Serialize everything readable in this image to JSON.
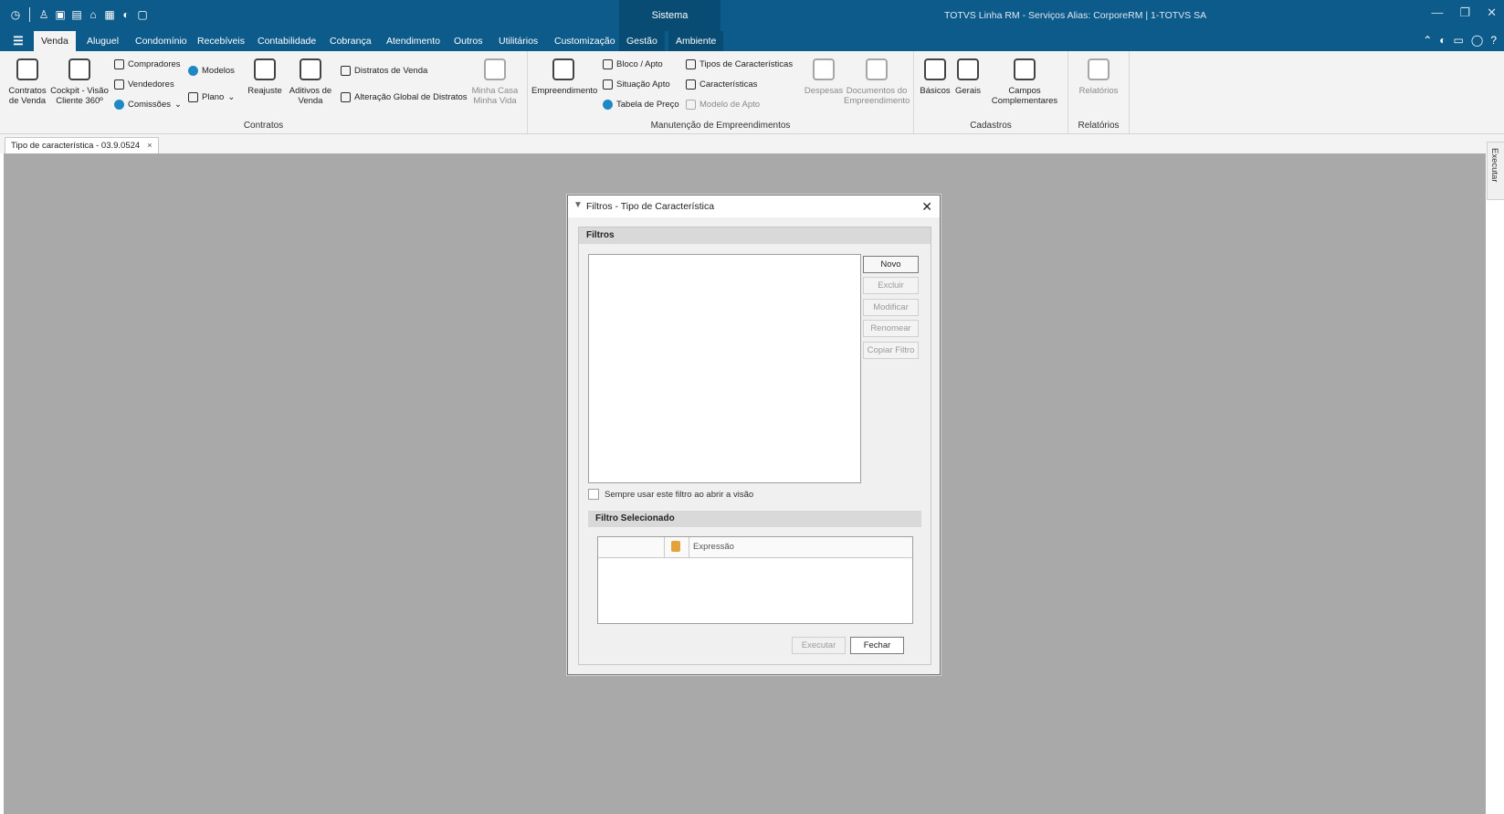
{
  "window": {
    "system_tab": "Sistema",
    "app_info": "TOTVS Linha RM - Serviços  Alias: CorporeRM | 1-TOTVS SA"
  },
  "tabs": [
    "Venda",
    "Aluguel",
    "Condomínio",
    "Recebíveis",
    "Contabilidade",
    "Cobrança",
    "Atendimento",
    "Outros",
    "Utilitários",
    "Customização",
    "Gestão",
    "Ambiente"
  ],
  "ribbon": {
    "contratos": {
      "group_label": "Contratos",
      "contratos_venda": "Contratos de Venda",
      "cockpit": "Cockpit - Visão Cliente 360º",
      "compradores": "Compradores",
      "vendedores": "Vendedores",
      "comissoes": "Comissões",
      "modelos": "Modelos",
      "plano": "Plano",
      "reajuste": "Reajuste",
      "aditivos": "Aditivos de Venda",
      "distratos": "Distratos de Venda",
      "alteracao": "Alteração Global de Distratos",
      "minha_casa": "Minha Casa Minha Vida"
    },
    "manutencao": {
      "group_label": "Manutenção de Empreendimentos",
      "empreendimento": "Empreendimento",
      "bloco": "Bloco / Apto",
      "situacao": "Situação Apto",
      "tabela": "Tabela de Preço",
      "tipos_caract": "Tipos de Características",
      "caracteristicas": "Características",
      "modelo_apto": "Modelo de Apto",
      "despesas": "Despesas",
      "documentos": "Documentos do Empreendimento"
    },
    "cadastros": {
      "group_label": "Cadastros",
      "basicos": "Básicos",
      "gerais": "Gerais",
      "campos": "Campos Complementares"
    },
    "relatorios": {
      "group_label": "Relatórios",
      "relatorios": "Relatórios"
    }
  },
  "doc_tab": {
    "label": "Tipo de característica - 03.9.0524",
    "close": "×"
  },
  "side_panel": {
    "label": "Executar"
  },
  "dialog": {
    "title": "Filtros - Tipo de Característica",
    "close": "✕",
    "section_filtros": "Filtros",
    "buttons": {
      "novo": "Novo",
      "excluir": "Excluir",
      "modificar": "Modificar",
      "renomear": "Renomear",
      "copiar": "Copiar Filtro"
    },
    "checkbox": "Sempre usar este filtro ao abrir a visão",
    "section_selecionado": "Filtro Selecionado",
    "grid_header": "Expressão",
    "executar": "Executar",
    "fechar": "Fechar"
  }
}
